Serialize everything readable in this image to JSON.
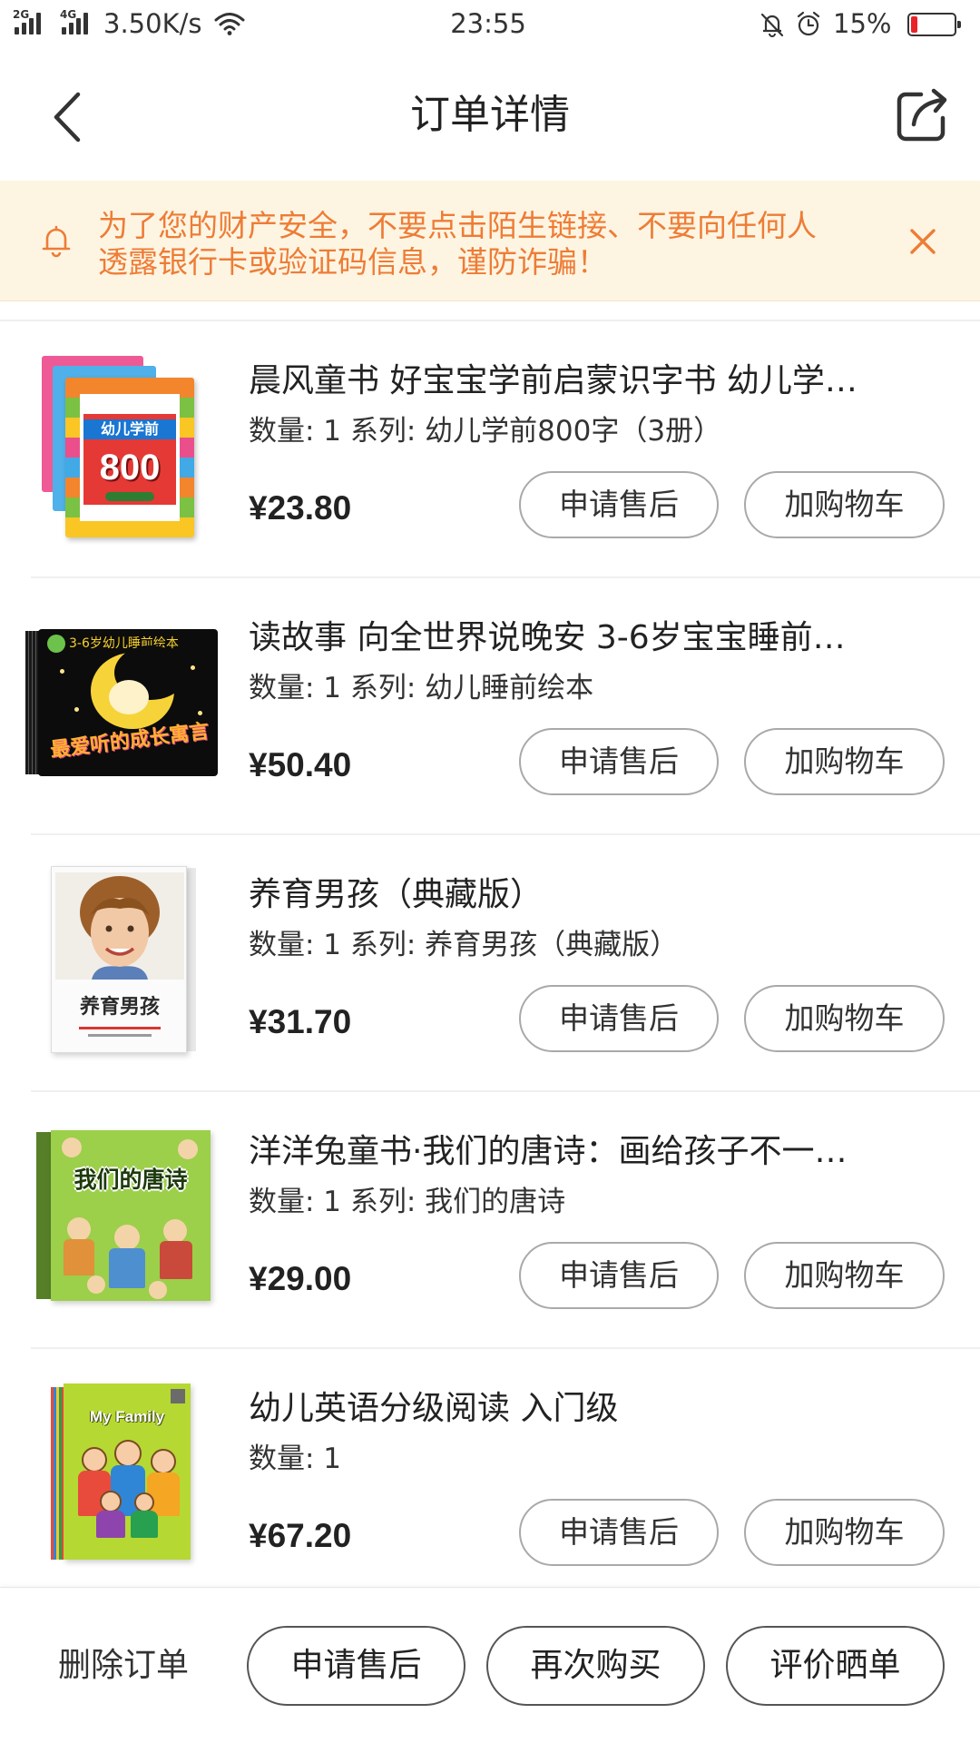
{
  "status_bar": {
    "sim1_network": "2G",
    "sim2_network": "4G",
    "net_speed": "3.50K/s",
    "time": "23:55",
    "battery_text": "15%",
    "battery_level": 0.15,
    "icons": [
      "signal-icon",
      "wifi-icon",
      "bell-off-icon",
      "alarm-clock-icon",
      "battery-icon"
    ]
  },
  "header": {
    "title": "订单详情",
    "back_icon": "back-arrow-icon",
    "share_icon": "share-icon"
  },
  "notice": {
    "line1": "为了您的财产安全，不要点击陌生链接、不要向任何人",
    "line2": "透露银行卡或验证码信息，谨防诈骗！",
    "icon": "bell-icon",
    "close_icon": "close-icon"
  },
  "item_actions": {
    "after_sale": "申请售后",
    "add_to_cart": "加购物车"
  },
  "items": [
    {
      "title": "晨风童书 好宝宝学前启蒙识字书 幼儿学…",
      "spec": "数量: 1 系列: 幼儿学前800字（3册）",
      "price": "¥23.80",
      "cover": {
        "label": "幼儿学前",
        "number": "800"
      }
    },
    {
      "title": "读故事 向全世界说晚安 3-6岁宝宝睡前…",
      "spec": "数量: 1 系列: 幼儿睡前绘本",
      "price": "¥50.40",
      "cover": {
        "top_text": "3-6岁幼儿睡前绘本",
        "title": "最爱听的成长寓言"
      }
    },
    {
      "title": "养育男孩（典藏版）",
      "spec": "数量: 1 系列: 养育男孩（典藏版）",
      "price": "¥31.70",
      "cover": {
        "title": "养育男孩"
      }
    },
    {
      "title": "洋洋兔童书·我们的唐诗：画给孩子不一…",
      "spec": "数量: 1 系列: 我们的唐诗",
      "price": "¥29.00",
      "cover": {
        "title": "我们的唐诗"
      }
    },
    {
      "title": "幼儿英语分级阅读 入门级",
      "spec": "数量: 1",
      "price": "¥67.20",
      "cover": {
        "title": "My Family"
      }
    }
  ],
  "footer": {
    "delete_order": "删除订单",
    "after_sale": "申请售后",
    "buy_again": "再次购买",
    "review": "评价晒单"
  },
  "colors": {
    "notice_bg": "#fdf5e2",
    "notice_text": "#ee7c36",
    "battery_low": "#e8242a"
  }
}
